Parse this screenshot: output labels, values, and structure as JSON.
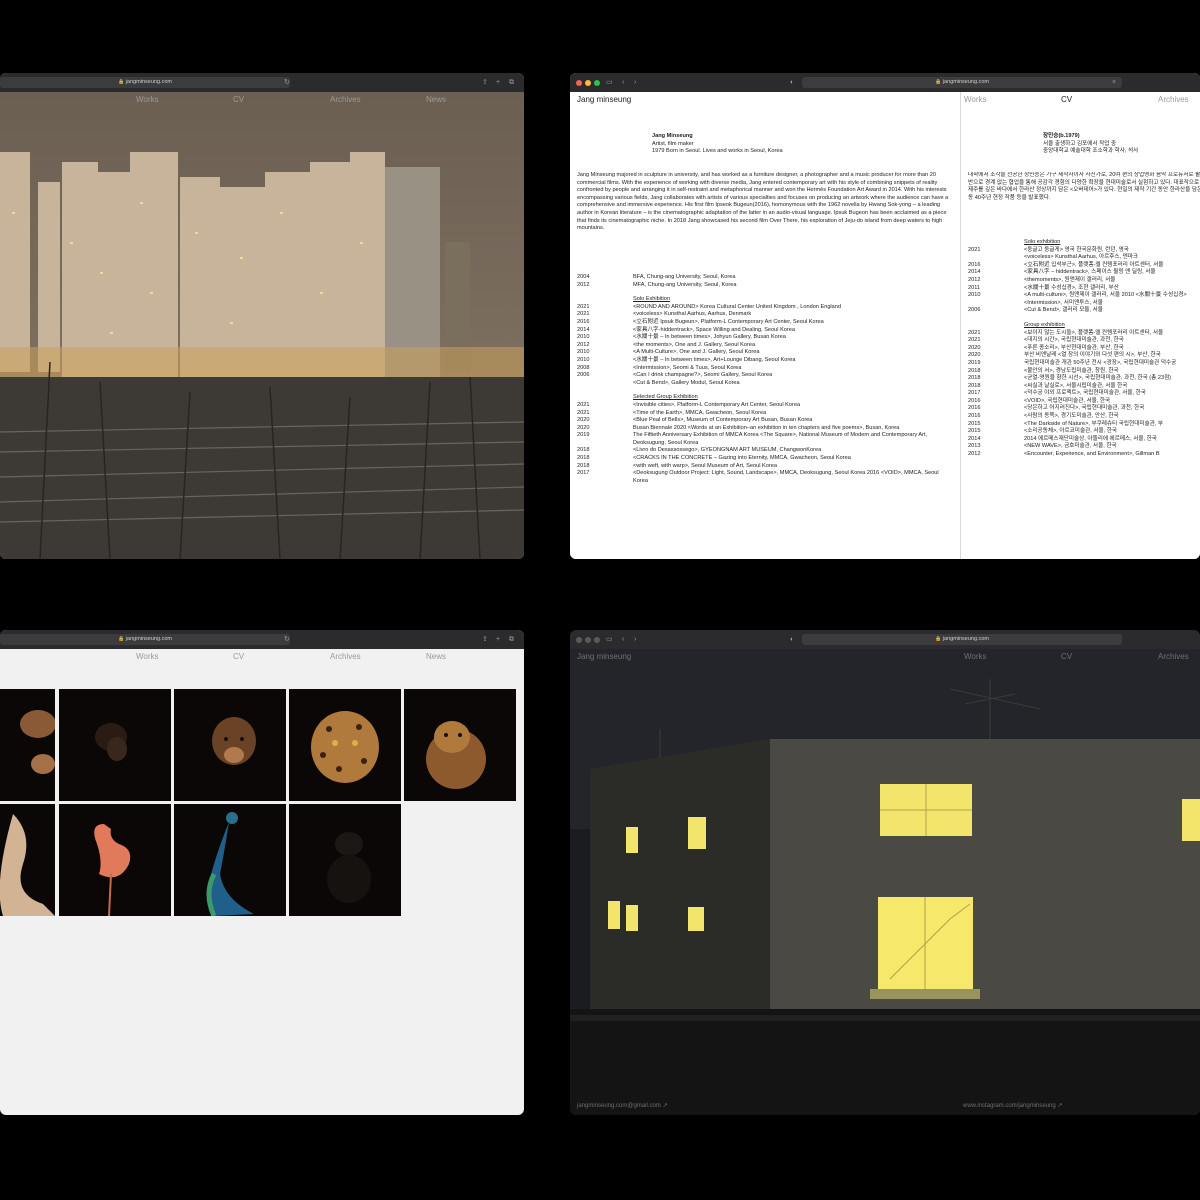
{
  "windows": {
    "works_photo": {
      "url": "jangminseung.com",
      "nav": [
        "Works",
        "CV",
        "Archives",
        "News"
      ]
    },
    "cv": {
      "url": "jangminseung.com",
      "site_title": "Jang minseung",
      "nav": [
        "Works",
        "CV",
        "Archives"
      ],
      "en": {
        "name": "Jang Minseung",
        "role": "Artist, film maker",
        "born": "1979 Born in Seoul. Lives and works in Seoul, Korea",
        "bio": "Jang Minseung majored in sculpture in university, and has worked as a furniture designer, a photographer and a music producer for more than 20 commercial films. With the experience of working with diverse media, Jang entered contemporary art with his style of combining snippets of reality confronted by people and arranging it in self-restraint and metaphorical manner and won the Hermès Foundation Art Award in 2014. With his interests encompassing various fields, Jang collaborates with artists of various specialties and focuses on producing an artwork where the audience can have a comprehensive and immersive experience. His first film Ipseok Bugeun(2016), homonymous with the 1962 novella by Hwang Sok-yong – a leading author in Korean literature – is the cinematographic adaptation of the latter in an audio-visual language. Ipsuk Bugeon has been acclaimed as a piece that finds its cinematographic niche. In 2018 Jang showcased his second film Over There, his exploration of Jeju-do island from deep waters to high mountains.",
        "education": [
          {
            "year": "2004",
            "item": "BFA, Chung-ang University, Seoul, Korea"
          },
          {
            "year": "2012",
            "item": "MFA, Chung-ang University, Seoul, Korea"
          }
        ],
        "solo_title": "Solo Exhibition",
        "solo": [
          {
            "year": "2021",
            "item": "<ROUND AND AROUND> Korea Cultural Center United Kingdom , London England"
          },
          {
            "year": "2021",
            "item": "<voiceless> Kunsthal Aarhus, Aarhus, Denmark"
          },
          {
            "year": "2016",
            "item": "<立石附近 Ipsuk Bugeun>, Platform-L Contemporary Art Center, Seoul Korea"
          },
          {
            "year": "2014",
            "item": "<家具八字-hiddentrack>, Space Willing and Dealing, Seoul Korea"
          },
          {
            "year": "2010",
            "item": "<水關十景 – In between times>, Johyun Gallery, Busan Korea"
          },
          {
            "year": "2012",
            "item": "<the moments>, One and J. Gallery, Seoul Korea"
          },
          {
            "year": "2010",
            "item": "<A Multi-Culture>, One and J. Gallery, Seoul Korea"
          },
          {
            "year": "2010",
            "item": "<水關十景 – In between times>, Art+Lounge Dibang, Seoul Korea"
          },
          {
            "year": "2008",
            "item": "<Intermission>, Seomi & Tuus, Seoul Korea"
          },
          {
            "year": "2006",
            "item": "<Can I drink champagne?>, Seomi Gallery, Seoul Korea"
          },
          {
            "year": "",
            "item": "<Cut & Bend>, Gallery Modul, Seoul Korea"
          }
        ],
        "group_title": "Selected Group Exhibition",
        "group": [
          {
            "year": "2021",
            "item": "<Invisible cities>, Platform-L Contemporary Art Center, Seoul Korea"
          },
          {
            "year": "2021",
            "item": "<Time of the Earth>, MMCA, Gwacheon, Seoul Korea"
          },
          {
            "year": "2020",
            "item": "<Blue Peal of Bells>, Museum of Contemporary Art Busan, Busan Korea"
          },
          {
            "year": "2020",
            "item": "Busan Biennale 2020 <Words at an Exhibition–an exhibition in ten chapters and five poems>, Busan, Korea"
          },
          {
            "year": "2019",
            "item": "The Fiftieth Anniversary Exhibition of MMCA Korea <The Square>, National Museum of Modern and Contemporary Art, Deoksugung, Seoul Korea"
          },
          {
            "year": "2018",
            "item": "<Livro do Desassossego>, GYEONGNAM ART MUSEUM, ChangwonKorea"
          },
          {
            "year": "2018",
            "item": "<CRACKS IN THE CONCRETE – Gazing into Eternity, MMCA, Gwacheon, Seoul Korea"
          },
          {
            "year": "2018",
            "item": "<with weft, with warp>, Seoul Museum of Art, Seoul Korea"
          },
          {
            "year": "2017",
            "item": "<Deoksugung Outdoor Project: Light, Sound, Landscape>, MMCA, Deoksugung, Seoul Korea 2016 <VOID>, MMCA, Seoul Korea"
          }
        ]
      },
      "ko": {
        "name": "장민승(b.1979)",
        "line1": "서울 출생하고 김포에서 작업 중",
        "line2": "중앙대학교 예술대학 조소학과 학사, 석사",
        "bio": "대학에서 조각을 전공한 장민승은 가구 제작자이자 사진가로, 20여 편의 상업영화 음악 프로듀서로 활동해왔다. 다양한 매체를 다뤄온 경험을 기반으로 경계 없는 협업을 통해 공감각 경험의 다양한 확장을 현대미술로서 실험하고 있다. 대표작으로 황석영 소설을 영상으로 옮긴 <입석부근>, 제주를 깊은 바다에서 한라산 정상까지 담은 <오버데어>가 있다. 현일의 제작 기간 동안 한라산을 담은 <오버데어 2018> 2020년 광주민주화운동 40주년 현정 작품 등을 발표했다.",
        "solo_title": "Solo exhibition",
        "solo": [
          {
            "year": "2021",
            "item": "<둥글고 둥글게> 영국 한국문화원, 런던, 영국"
          },
          {
            "year": "",
            "item": "<voiceless> Kunsthal Aarhus, 아르후스, 덴마크"
          },
          {
            "year": "2016",
            "item": "<立石附近 입석부근>, 플랫폼-엘 컨템포러리 아트센터, 서울"
          },
          {
            "year": "2014",
            "item": "<家具八字 – hiddentrack>, 스페이스 윌링 앤 딜링, 서울"
          },
          {
            "year": "2012",
            "item": "<themoments>, 원앤제이 갤러리, 서울"
          },
          {
            "year": "2011",
            "item": "<水關十景 수성십경>, 조현 갤러리, 부산"
          },
          {
            "year": "2010",
            "item": "<A multi-culture>, 원앤제이 갤러리, 서울 2010 <水關十景 수성십경>"
          },
          {
            "year": "",
            "item": "<Intermission>, 서미앤투스, 서울"
          },
          {
            "year": "2006",
            "item": "<Cut & Bend>, 갤러리 모듈, 서울"
          }
        ],
        "group_title": "Group exhibition",
        "group": [
          {
            "year": "2021",
            "item": "<보이지 않는 도시들>, 플랫폼-엘 컨템포러리 아트센터, 서울"
          },
          {
            "year": "2021",
            "item": "<대지의 시간>, 국립현대미술관, 과천, 한국"
          },
          {
            "year": "2020",
            "item": "<푸른 종소리>, 부산현대미술관, 부산, 한국"
          },
          {
            "year": "2020",
            "item": "부산 비엔날레 <열 장의 이야기와 다섯 편의 시>, 부산, 한국"
          },
          {
            "year": "2019",
            "item": "국립현대미술관 개관 50주년 전시 <광장>, 국립현대미술관 덕수궁"
          },
          {
            "year": "2018",
            "item": "<불안의 서>, 경남도립미술관, 창원, 한국"
          },
          {
            "year": "2018",
            "item": "<균열-영원을 향한 시선>, 국립현대미술관, 과천, 한국 (총 23점)"
          },
          {
            "year": "2018",
            "item": "<씨실과 날실로>, 서울시립미술관, 서울 한국"
          },
          {
            "year": "2017",
            "item": "<덕수궁 야외 프로젝트>, 국립현대미술관, 서울, 한국"
          },
          {
            "year": "2016",
            "item": "<VOID>, 국립현대미술관, 서울, 한국"
          },
          {
            "year": "2016",
            "item": "<당은하고 어지러진다>, 국립현대미술관, 과천, 한국"
          },
          {
            "year": "2016",
            "item": "<사람의 동쪽>, 경기도미술관, 안산, 한국"
          },
          {
            "year": "2015",
            "item": "<The Darkside of Nature>, 부쿠레슈티 국립현대미술관, 부"
          },
          {
            "year": "2015",
            "item": "<소리공동체>, 아르코미술관, 서울, 한국"
          },
          {
            "year": "2014",
            "item": "2014 에르메스재단미술상, 아뜰리에 에르메스, 서울, 한국"
          },
          {
            "year": "2013",
            "item": "<NEW WAVE>, 금호미술관, 서울, 한국"
          },
          {
            "year": "2012",
            "item": "<Encounter, Experience, and Environment>, Gillman B"
          }
        ]
      }
    },
    "works_grid": {
      "url": "jangminseung.com",
      "nav": [
        "Works",
        "CV",
        "Archives",
        "News"
      ]
    },
    "works_night": {
      "url": "jangminseung.com",
      "site_title": "Jang minseung",
      "nav": [
        "Works",
        "CV",
        "Archives"
      ],
      "footer_email": "jangminseung.com@gmail.com ↗",
      "footer_instagram": "www.instagram.com/jangminseung ↗"
    }
  },
  "colors": {
    "chrome": "#2b2b2d",
    "nav_text": "#9a9a9a",
    "window_light": "#f2f2f2",
    "window_yellow": "#f3e46b"
  }
}
